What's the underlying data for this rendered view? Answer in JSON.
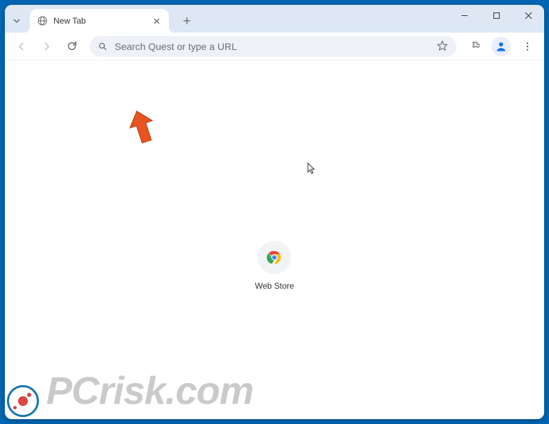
{
  "tab": {
    "title": "New Tab"
  },
  "omnibox": {
    "placeholder": "Search Quest or type a URL"
  },
  "shortcuts": {
    "webstore": {
      "label": "Web Store"
    }
  },
  "watermark": {
    "text": "PCrisk.com"
  },
  "icons": {
    "chevron_down": "chevron-down",
    "globe": "globe",
    "close": "close",
    "plus": "plus",
    "minimize": "minimize",
    "maximize": "maximize",
    "window_close": "window-close",
    "back": "back",
    "forward": "forward",
    "reload": "reload",
    "search": "search",
    "star": "star",
    "extensions": "extensions",
    "profile": "profile",
    "menu": "menu"
  }
}
